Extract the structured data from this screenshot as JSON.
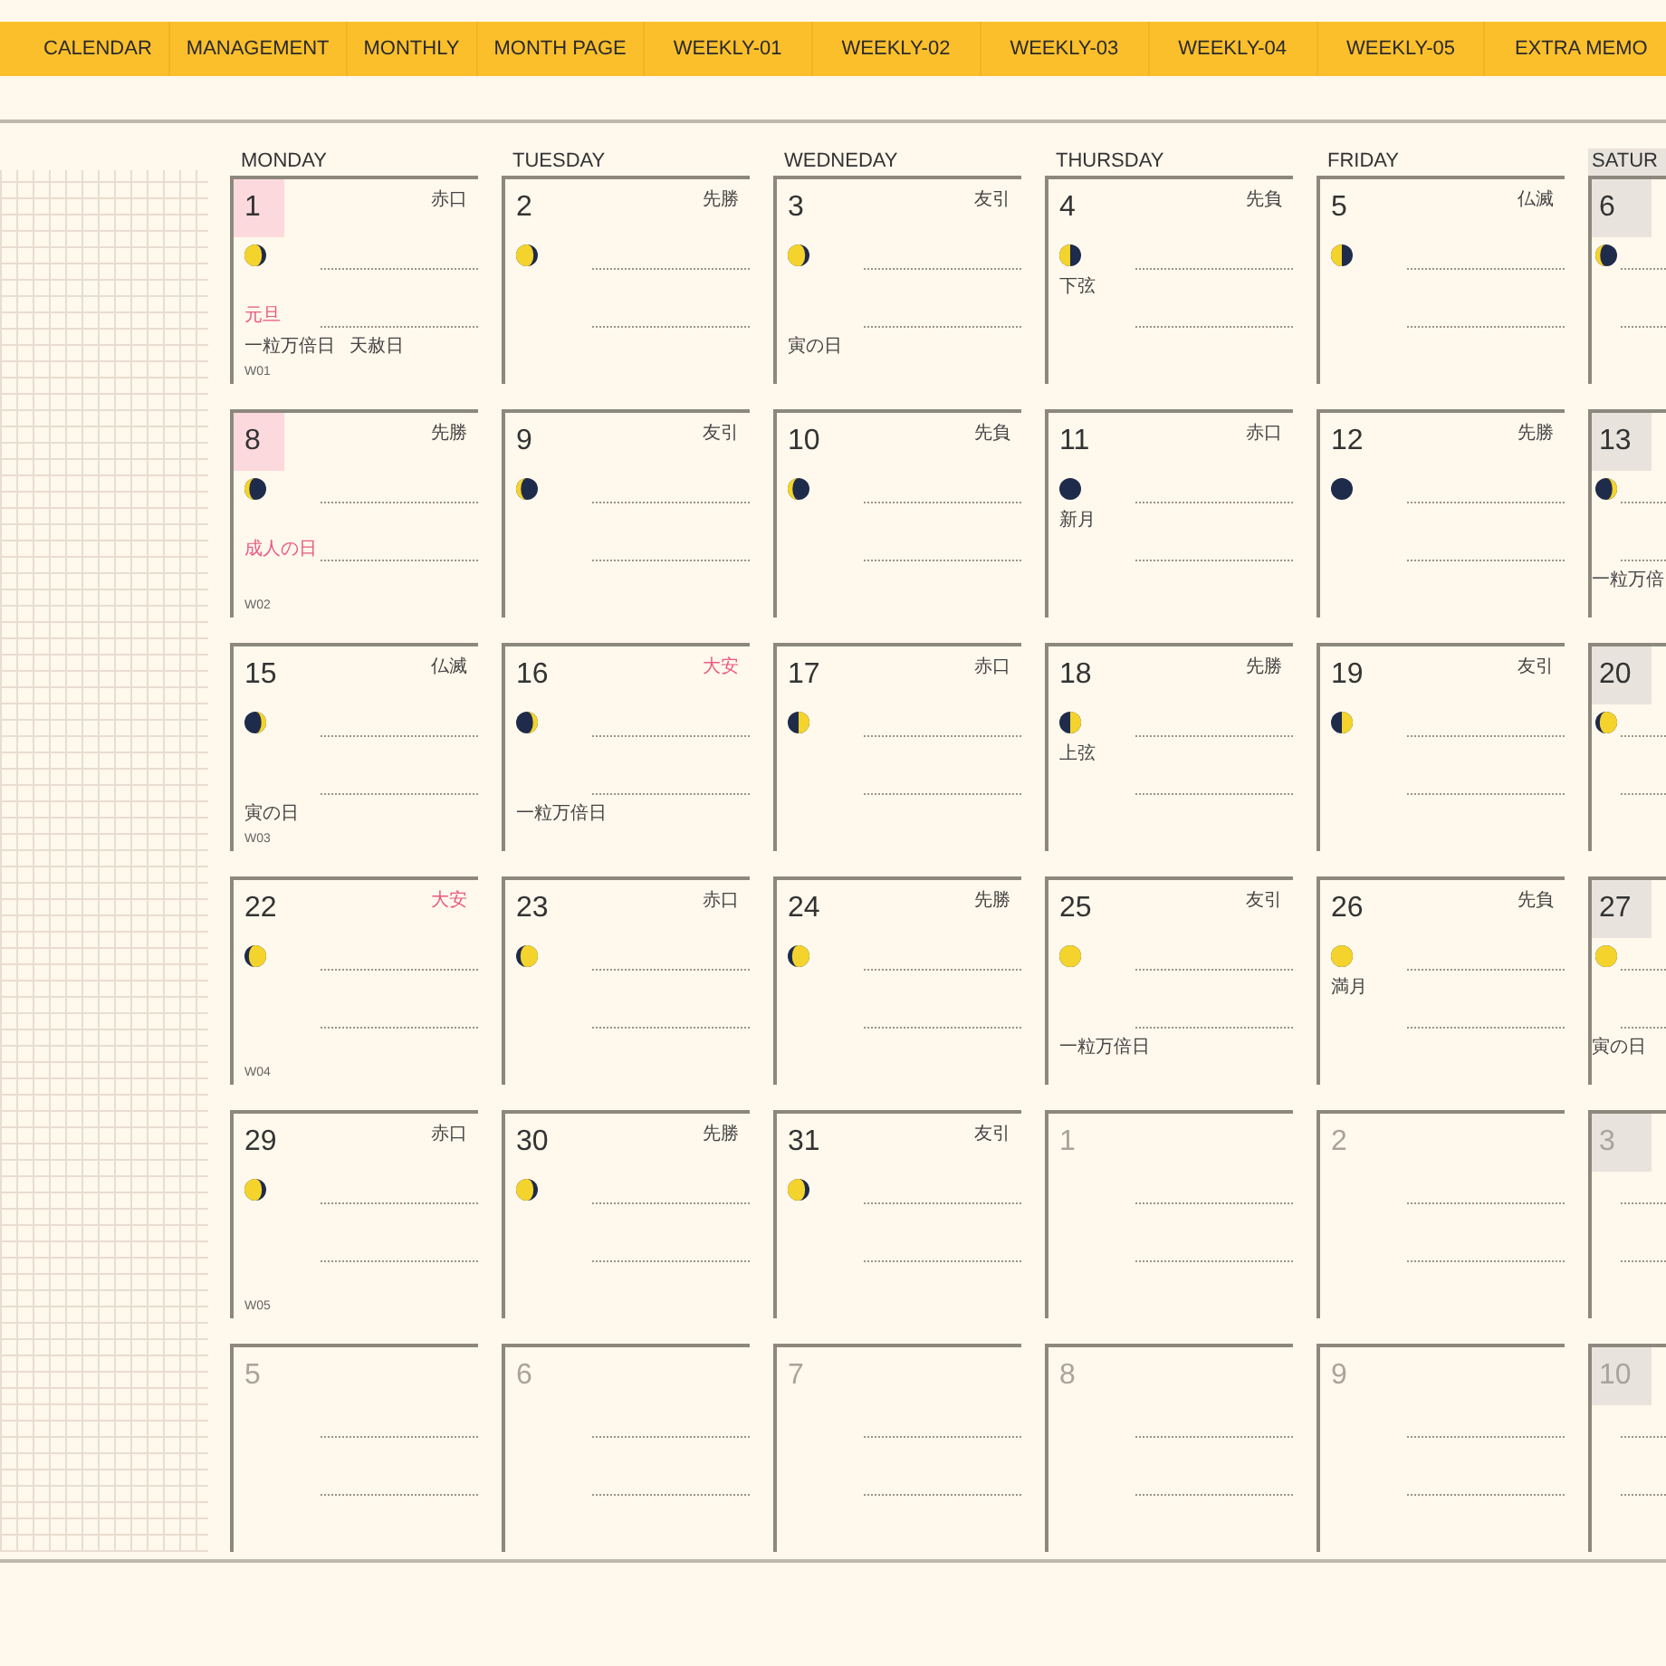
{
  "tabs": [
    {
      "label": "CALENDAR"
    },
    {
      "label": "MANAGEMENT"
    },
    {
      "label": "MONTHLY"
    },
    {
      "label": "MONTH PAGE"
    },
    {
      "label": "WEEKLY-01"
    },
    {
      "label": "WEEKLY-02"
    },
    {
      "label": "WEEKLY-03"
    },
    {
      "label": "WEEKLY-04"
    },
    {
      "label": "WEEKLY-05"
    },
    {
      "label": "EXTRA MEMO"
    }
  ],
  "weekdays": [
    {
      "label": "MONDAY",
      "shaded": false
    },
    {
      "label": "TUESDAY",
      "shaded": false
    },
    {
      "label": "WEDNEDAY",
      "shaded": false
    },
    {
      "label": "THURSDAY",
      "shaded": false
    },
    {
      "label": "FRIDAY",
      "shaded": false
    },
    {
      "label": "SATUR",
      "shaded": true
    }
  ],
  "weeks": [
    {
      "week": "W01",
      "days": [
        {
          "date": "1",
          "in_month": true,
          "holiday": true,
          "rokuyo": "赤口",
          "auspicious": false,
          "moon": {
            "kind": "waning-gibbous"
          },
          "note": "元旦",
          "events": [
            "一粒万倍日",
            "天赦日"
          ]
        },
        {
          "date": "2",
          "in_month": true,
          "holiday": false,
          "rokuyo": "先勝",
          "auspicious": false,
          "moon": {
            "kind": "waning-gibbous"
          }
        },
        {
          "date": "3",
          "in_month": true,
          "holiday": false,
          "rokuyo": "友引",
          "auspicious": false,
          "moon": {
            "kind": "waning-gibbous"
          },
          "events": [
            "寅の日"
          ]
        },
        {
          "date": "4",
          "in_month": true,
          "holiday": false,
          "rokuyo": "先負",
          "auspicious": false,
          "moon": {
            "kind": "last-quarter"
          },
          "moon_label": "下弦"
        },
        {
          "date": "5",
          "in_month": true,
          "holiday": false,
          "rokuyo": "仏滅",
          "auspicious": false,
          "moon": {
            "kind": "last-quarter"
          }
        },
        {
          "date": "6",
          "in_month": true,
          "holiday": false,
          "moon": {
            "kind": "waning-crescent"
          }
        }
      ]
    },
    {
      "week": "W02",
      "days": [
        {
          "date": "8",
          "in_month": true,
          "holiday": true,
          "rokuyo": "先勝",
          "auspicious": false,
          "moon": {
            "kind": "waning-crescent"
          },
          "note": "成人の日"
        },
        {
          "date": "9",
          "in_month": true,
          "holiday": false,
          "rokuyo": "友引",
          "auspicious": false,
          "moon": {
            "kind": "waning-crescent"
          }
        },
        {
          "date": "10",
          "in_month": true,
          "holiday": false,
          "rokuyo": "先負",
          "auspicious": false,
          "moon": {
            "kind": "waning-crescent"
          }
        },
        {
          "date": "11",
          "in_month": true,
          "holiday": false,
          "rokuyo": "赤口",
          "auspicious": false,
          "moon": {
            "kind": "new"
          },
          "moon_label": "新月"
        },
        {
          "date": "12",
          "in_month": true,
          "holiday": false,
          "rokuyo": "先勝",
          "auspicious": false,
          "moon": {
            "kind": "new"
          }
        },
        {
          "date": "13",
          "in_month": true,
          "holiday": false,
          "moon": {
            "kind": "waxing-crescent"
          },
          "events": [
            "一粒万倍"
          ]
        }
      ]
    },
    {
      "week": "W03",
      "days": [
        {
          "date": "15",
          "in_month": true,
          "holiday": false,
          "rokuyo": "仏滅",
          "auspicious": false,
          "moon": {
            "kind": "waxing-crescent"
          },
          "events": [
            "寅の日"
          ]
        },
        {
          "date": "16",
          "in_month": true,
          "holiday": false,
          "rokuyo": "大安",
          "auspicious": true,
          "moon": {
            "kind": "waxing-crescent"
          },
          "events": [
            "一粒万倍日"
          ]
        },
        {
          "date": "17",
          "in_month": true,
          "holiday": false,
          "rokuyo": "赤口",
          "auspicious": false,
          "moon": {
            "kind": "first-quarter"
          }
        },
        {
          "date": "18",
          "in_month": true,
          "holiday": false,
          "rokuyo": "先勝",
          "auspicious": false,
          "moon": {
            "kind": "first-quarter"
          },
          "moon_label": "上弦"
        },
        {
          "date": "19",
          "in_month": true,
          "holiday": false,
          "rokuyo": "友引",
          "auspicious": false,
          "moon": {
            "kind": "first-quarter"
          }
        },
        {
          "date": "20",
          "in_month": true,
          "holiday": false,
          "moon": {
            "kind": "waxing-gibbous"
          }
        }
      ]
    },
    {
      "week": "W04",
      "days": [
        {
          "date": "22",
          "in_month": true,
          "holiday": false,
          "rokuyo": "大安",
          "auspicious": true,
          "moon": {
            "kind": "waxing-gibbous"
          }
        },
        {
          "date": "23",
          "in_month": true,
          "holiday": false,
          "rokuyo": "赤口",
          "auspicious": false,
          "moon": {
            "kind": "waxing-gibbous"
          }
        },
        {
          "date": "24",
          "in_month": true,
          "holiday": false,
          "rokuyo": "先勝",
          "auspicious": false,
          "moon": {
            "kind": "waxing-gibbous"
          }
        },
        {
          "date": "25",
          "in_month": true,
          "holiday": false,
          "rokuyo": "友引",
          "auspicious": false,
          "moon": {
            "kind": "full"
          },
          "events": [
            "一粒万倍日"
          ]
        },
        {
          "date": "26",
          "in_month": true,
          "holiday": false,
          "rokuyo": "先負",
          "auspicious": false,
          "moon": {
            "kind": "full"
          },
          "moon_label": "満月"
        },
        {
          "date": "27",
          "in_month": true,
          "holiday": false,
          "moon": {
            "kind": "full"
          },
          "events": [
            "寅の日"
          ]
        }
      ]
    },
    {
      "week": "W05",
      "days": [
        {
          "date": "29",
          "in_month": true,
          "holiday": false,
          "rokuyo": "赤口",
          "auspicious": false,
          "moon": {
            "kind": "waning-gibbous"
          }
        },
        {
          "date": "30",
          "in_month": true,
          "holiday": false,
          "rokuyo": "先勝",
          "auspicious": false,
          "moon": {
            "kind": "waning-gibbous"
          }
        },
        {
          "date": "31",
          "in_month": true,
          "holiday": false,
          "rokuyo": "友引",
          "auspicious": false,
          "moon": {
            "kind": "waning-gibbous"
          }
        },
        {
          "date": "1",
          "in_month": false,
          "holiday": false
        },
        {
          "date": "2",
          "in_month": false,
          "holiday": false
        },
        {
          "date": "3",
          "in_month": false,
          "holiday": false
        }
      ]
    },
    {
      "days": [
        {
          "date": "5",
          "in_month": false,
          "holiday": false
        },
        {
          "date": "6",
          "in_month": false,
          "holiday": false
        },
        {
          "date": "7",
          "in_month": false,
          "holiday": false
        },
        {
          "date": "8",
          "in_month": false,
          "holiday": false
        },
        {
          "date": "9",
          "in_month": false,
          "holiday": false
        },
        {
          "date": "10",
          "in_month": false,
          "holiday": false
        }
      ]
    }
  ]
}
